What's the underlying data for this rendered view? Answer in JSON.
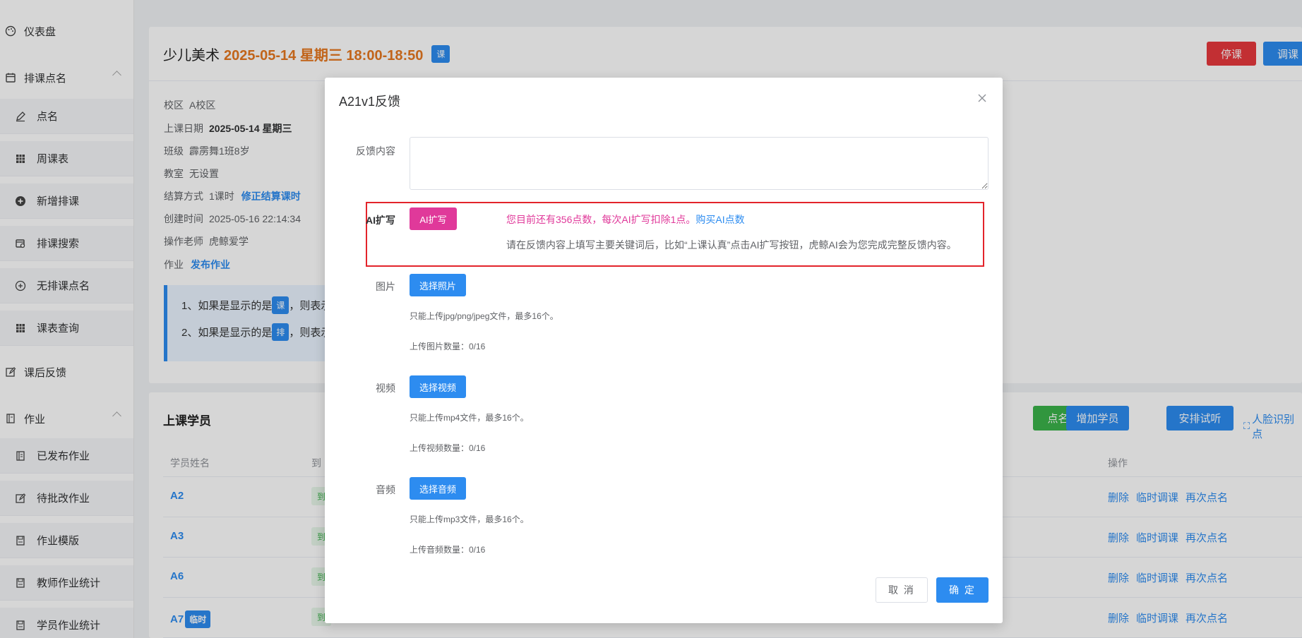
{
  "sidebar": {
    "dashboard": "仪表盘",
    "group_schedule": "排课点名",
    "items_schedule": [
      "点名",
      "周课表",
      "新增排课",
      "排课搜索",
      "无排课点名",
      "课表查询"
    ],
    "feedback": "课后反馈",
    "group_homework": "作业",
    "items_homework": [
      "已发布作业",
      "待批改作业",
      "作业模版",
      "教师作业统计",
      "学员作业统计"
    ]
  },
  "lesson": {
    "course": "少儿美术",
    "time": "2025-05-14 星期三 18:00-18:50",
    "tag": "课",
    "btn_stop": "停课",
    "btn_adjust": "调课"
  },
  "info": {
    "campus_label": "校区",
    "campus": "A校区",
    "date_label": "上课日期",
    "date": "2025-05-14 星期三",
    "class_label": "班级",
    "class": "霹雳舞1班8岁",
    "room_label": "教室",
    "room": "无设置",
    "settle_label": "结算方式",
    "settle": "1课时",
    "settle_link": "修正结算课时",
    "created_label": "创建时间",
    "created": "2025-05-16 22:14:34",
    "teacher_label": "操作老师",
    "teacher": "虎鲸爱学",
    "homework_label": "作业",
    "homework_link": "发布作业"
  },
  "notice": {
    "line1_pre": "1、如果是显示的是",
    "line1_tag": "课",
    "line1_post": "，则表示",
    "line2_pre": "2、如果是显示的是",
    "line2_tag": "排",
    "line2_post": "，则表示"
  },
  "students": {
    "title": "上课学员",
    "btn_rollcall": "点名",
    "btn_add": "增加学员",
    "btn_trial": "安排试听",
    "face_link": "人脸识别点",
    "col_name": "学员姓名",
    "col_status": "到",
    "col_ops": "操作",
    "badge": "到",
    "rows": [
      {
        "name": "A2",
        "tag": ""
      },
      {
        "name": "A3",
        "tag": ""
      },
      {
        "name": "A6",
        "tag": ""
      },
      {
        "name": "A7",
        "tag": "临时"
      }
    ],
    "ops": [
      "删除",
      "临时调课",
      "再次点名"
    ]
  },
  "modal": {
    "title": "A21v1反馈",
    "feedback_label": "反馈内容",
    "feedback_value": "",
    "ai_label": "AI扩写",
    "ai_button": "AI扩写",
    "ai_msg": "您目前还有356点数，每次AI扩写扣除1点。",
    "ai_buy": "购买AI点数",
    "ai_hint": "请在反馈内容上填写主要关键词后，比如“上课认真”点击AI扩写按钮，虎鲸AI会为您完成完整反馈内容。",
    "photo_label": "图片",
    "photo_button": "选择照片",
    "photo_tip": "只能上传jpg/png/jpeg文件，最多16个。",
    "photo_count": "上传图片数量：0/16",
    "video_label": "视频",
    "video_button": "选择视频",
    "video_tip": "只能上传mp4文件，最多16个。",
    "video_count": "上传视频数量：0/16",
    "audio_label": "音频",
    "audio_button": "选择音频",
    "audio_tip": "只能上传mp3文件，最多16个。",
    "audio_count": "上传音频数量：0/16",
    "cancel": "取 消",
    "confirm": "确 定"
  },
  "colors": {
    "primary": "#2d8cf0",
    "danger": "#e8383d",
    "success": "#3bb34a",
    "ai_pink": "#e0399a",
    "highlight_border": "#e3242b",
    "time_orange": "#e6781f"
  }
}
